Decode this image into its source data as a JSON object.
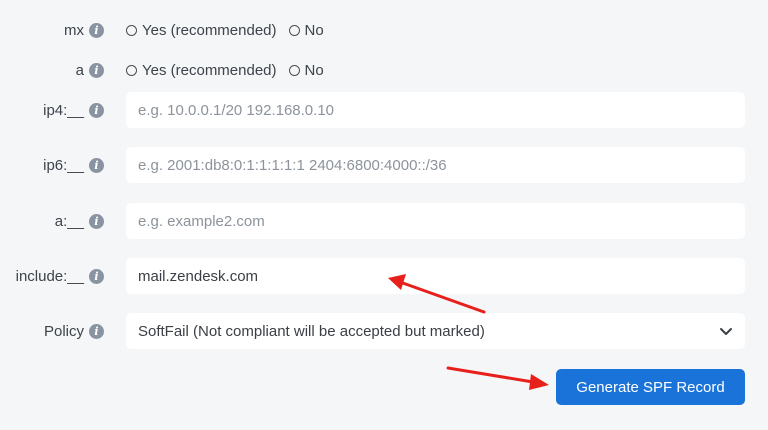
{
  "rows": [
    {
      "label": "mx",
      "type": "radio",
      "options": [
        "Yes (recommended)",
        "No"
      ]
    },
    {
      "label": "a",
      "type": "radio",
      "options": [
        "Yes (recommended)",
        "No"
      ]
    },
    {
      "label": "ip4:__",
      "type": "text",
      "placeholder": "e.g. 10.0.0.1/20 192.168.0.10",
      "value": ""
    },
    {
      "label": "ip6:__",
      "type": "text",
      "placeholder": "e.g. 2001:db8:0:1:1:1:1:1 2404:6800:4000::/36",
      "value": ""
    },
    {
      "label": "a:__",
      "type": "text",
      "placeholder": "e.g. example2.com",
      "value": ""
    },
    {
      "label": "include:__",
      "type": "text",
      "placeholder": "",
      "value": "mail.zendesk.com"
    },
    {
      "label": "Policy",
      "type": "select",
      "selected": "SoftFail (Not compliant will be accepted but marked)"
    }
  ],
  "info_icon_glyph": "i",
  "submit_label": "Generate SPF Record",
  "colors": {
    "background": "#f5f6f8",
    "button": "#1a73d9",
    "annotation_arrow": "#e8201c"
  }
}
